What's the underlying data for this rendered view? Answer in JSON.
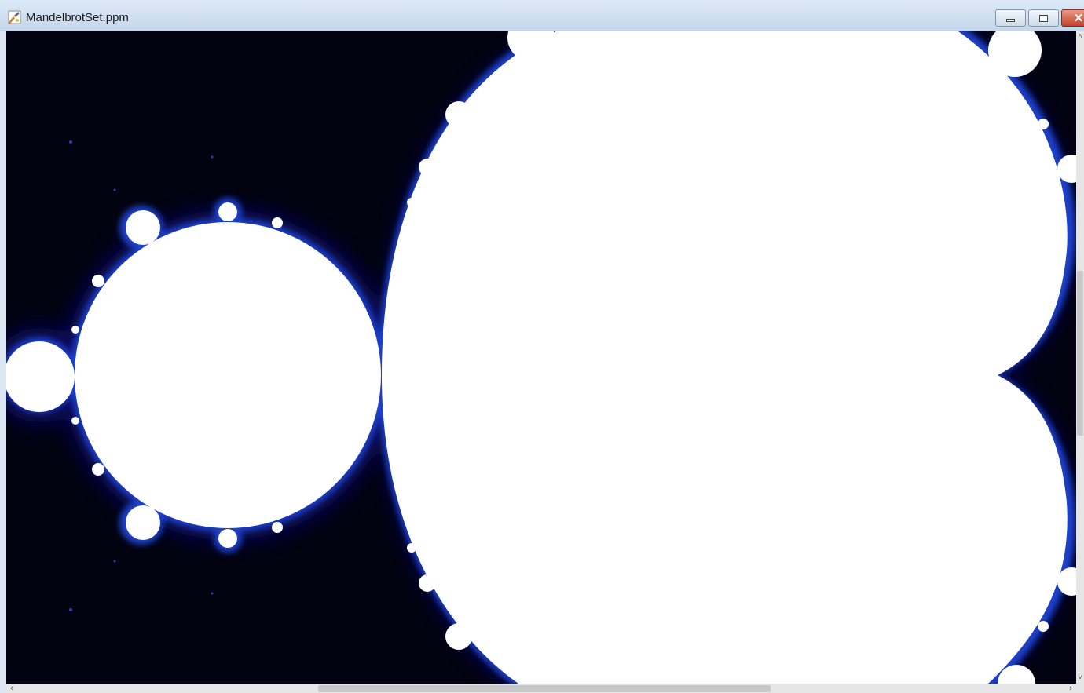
{
  "window": {
    "title": "MandelbrotSet.ppm",
    "app_icon": "paint-icon",
    "controls": {
      "minimize_icon": "minimize-icon",
      "maximize_icon": "maximize-icon",
      "close_icon": "close-icon",
      "close_glyph": "✕"
    }
  },
  "image": {
    "subject": "mandelbrot-set",
    "colors": {
      "background": "#020210",
      "set": "#ffffff",
      "edge_glow": "#1a3fc8",
      "edge_dark": "#0a1170"
    }
  },
  "scrollbars": {
    "vertical": {
      "up_glyph": "˄",
      "down_glyph": "˅"
    },
    "horizontal": {
      "left_glyph": "‹",
      "right_glyph": "›"
    }
  }
}
